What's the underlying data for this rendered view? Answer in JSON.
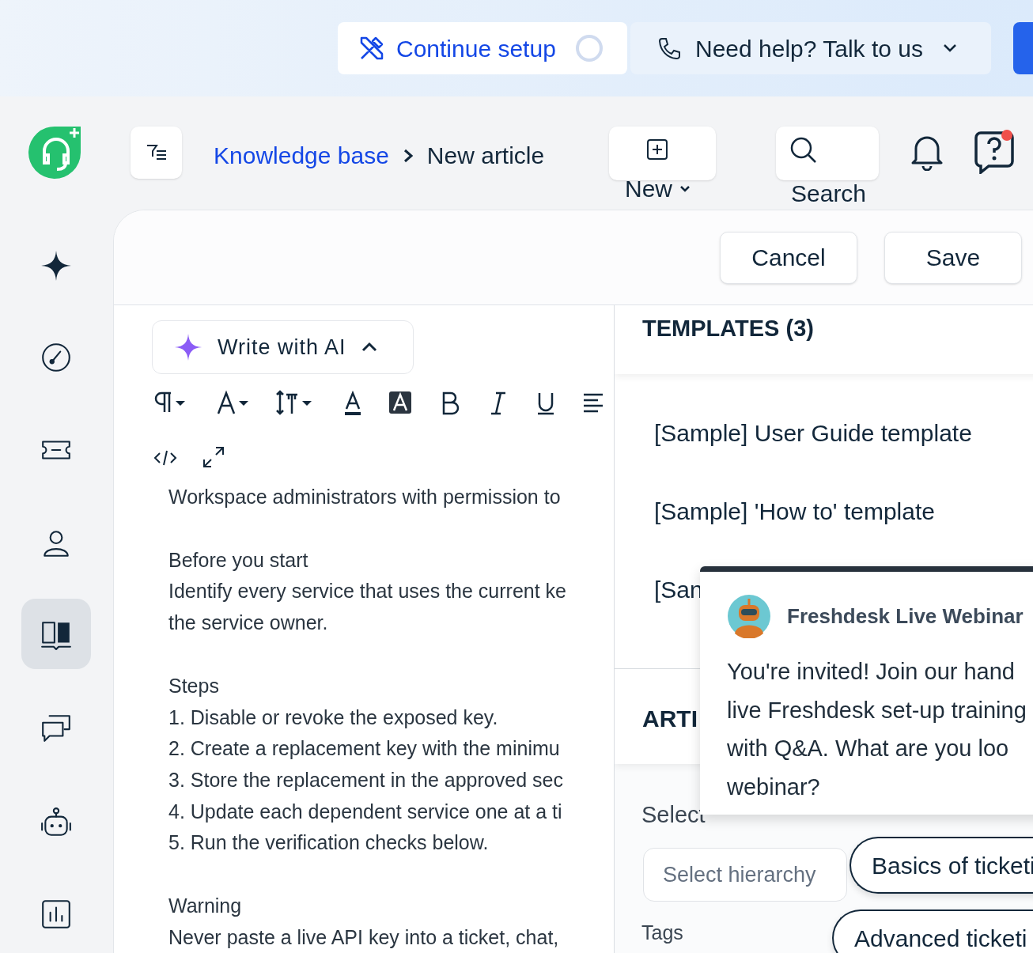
{
  "top_bar": {
    "setup_button": {
      "label": "Continue setup"
    },
    "help_button": {
      "label": "Need help? Talk to us"
    }
  },
  "header": {
    "breadcrumb": [
      {
        "label": "Knowledge base",
        "kind": "link"
      },
      {
        "label": "New article",
        "kind": "current"
      }
    ],
    "new_button": {
      "label": "New"
    },
    "search_button": {
      "label": "Search"
    },
    "help_notification": true
  },
  "sidebar": {
    "items": [
      {
        "kind": "sparkle",
        "selected": false
      },
      {
        "kind": "dashboard",
        "selected": false
      },
      {
        "kind": "ticket",
        "selected": false
      },
      {
        "kind": "contact",
        "selected": false
      },
      {
        "kind": "book",
        "selected": true
      },
      {
        "kind": "chat",
        "selected": false
      },
      {
        "kind": "bot",
        "selected": false
      },
      {
        "kind": "report",
        "selected": false
      }
    ]
  },
  "actions": [
    {
      "label": "Cancel"
    },
    {
      "label": "Save"
    }
  ],
  "editor": {
    "ai_button": {
      "label": "Write with AI"
    },
    "paragraphs": [
      [
        "Workspace administrators with permission to"
      ],
      [
        "Before you start",
        "Identify every service that uses the current ke",
        "the service owner."
      ],
      [
        "Steps",
        "1. Disable or revoke the exposed key.",
        "2. Create a replacement key with the minimu",
        "3. Store the replacement in the approved sec",
        "4. Update each dependent service one at a ti",
        "5. Run the verification checks below."
      ],
      [
        "Warning",
        "Never paste a live API key into a ticket, chat,"
      ]
    ]
  },
  "templates": {
    "title": "TEMPLATES (3)",
    "items": [
      "[Sample] User Guide template",
      "[Sample] 'How to' template",
      "[San"
    ]
  },
  "article_section": {
    "title": "ARTI",
    "hierarchy_label": "Select",
    "hierarchy_placeholder": "Select hierarchy",
    "tags_label": "Tags",
    "chips": [
      "Basics of ticketi",
      "Advanced ticketi"
    ]
  },
  "webinar_popup": {
    "title": "Freshdesk Live Webinar",
    "lines": [
      "You're invited! Join our hand",
      "live Freshdesk set-up training",
      "with Q&A. What are you loo",
      "webinar?"
    ]
  }
}
